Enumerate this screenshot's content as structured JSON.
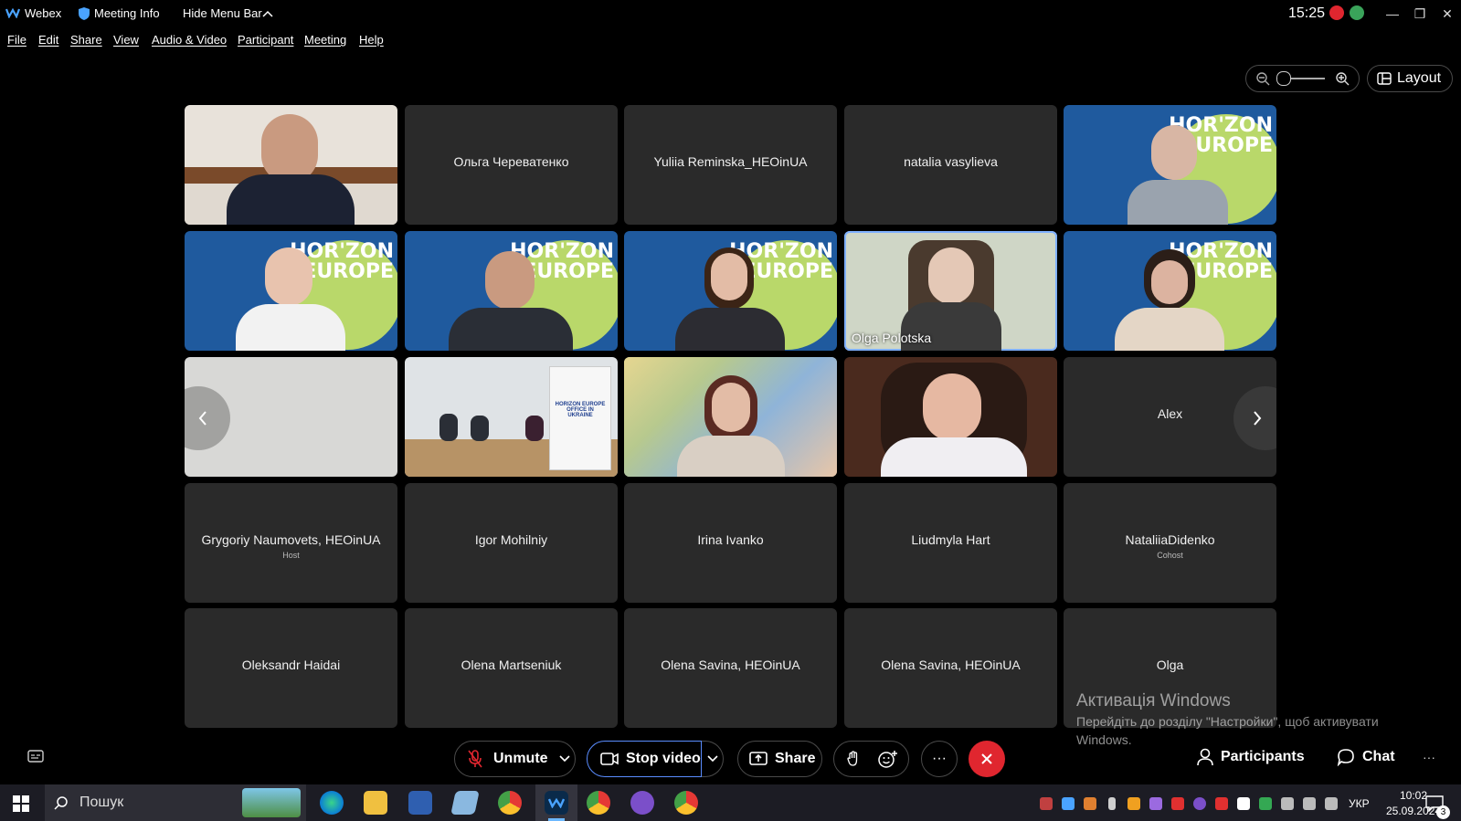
{
  "titlebar": {
    "app": "Webex",
    "meeting_info": "Meeting Info",
    "hide_menu": "Hide Menu Bar",
    "clock": "15:25"
  },
  "menu": [
    "File",
    "Edit",
    "Share",
    "View",
    "Audio & Video",
    "Participant",
    "Meeting",
    "Help"
  ],
  "layout_label": "Layout",
  "tiles": {
    "r1c2": "Ольга Череватенко",
    "r1c3": "Yuliia Reminska_HEOinUA",
    "r1c4": "natalia vasylieva",
    "r2c4_label": "Olga Polotska",
    "r3c5": "Alex",
    "r4c1": "Grygoriy Naumovets, HEOinUA",
    "r4c1_role": "Host",
    "r4c2": "Igor Mohilniy",
    "r4c3": "Irina Ivanko",
    "r4c4": "Liudmyla Hart",
    "r4c5": "NataliiaDidenko",
    "r4c5_role": "Cohost",
    "r5c1": "Oleksandr Haidai",
    "r5c2": "Olena Martseniuk",
    "r5c3": "Olena Savina, HEOinUA",
    "r5c4": "Olena Savina, HEOinUA",
    "r5c5": "Olga"
  },
  "horizon_text": [
    "HOR'ZON",
    "EUROPE"
  ],
  "banner_text": [
    "HORIZON EUROPE",
    "OFFICE IN",
    "UKRAINE"
  ],
  "watermark": {
    "title": "Активація Windows",
    "line1": "Перейдіть до розділу \"Настройки\", щоб активувати",
    "line2": "Windows."
  },
  "controls": {
    "unmute": "Unmute",
    "stop_video": "Stop video",
    "share": "Share",
    "participants": "Participants",
    "chat": "Chat",
    "more": "···"
  },
  "taskbar": {
    "search": "Пошук",
    "lang": "УКР",
    "time": "10:02",
    "date": "25.09.2024",
    "notif": "3"
  },
  "colors": {
    "accent": "#2b7fff",
    "leave": "#e0262f",
    "tile": "#2a2a2a"
  }
}
